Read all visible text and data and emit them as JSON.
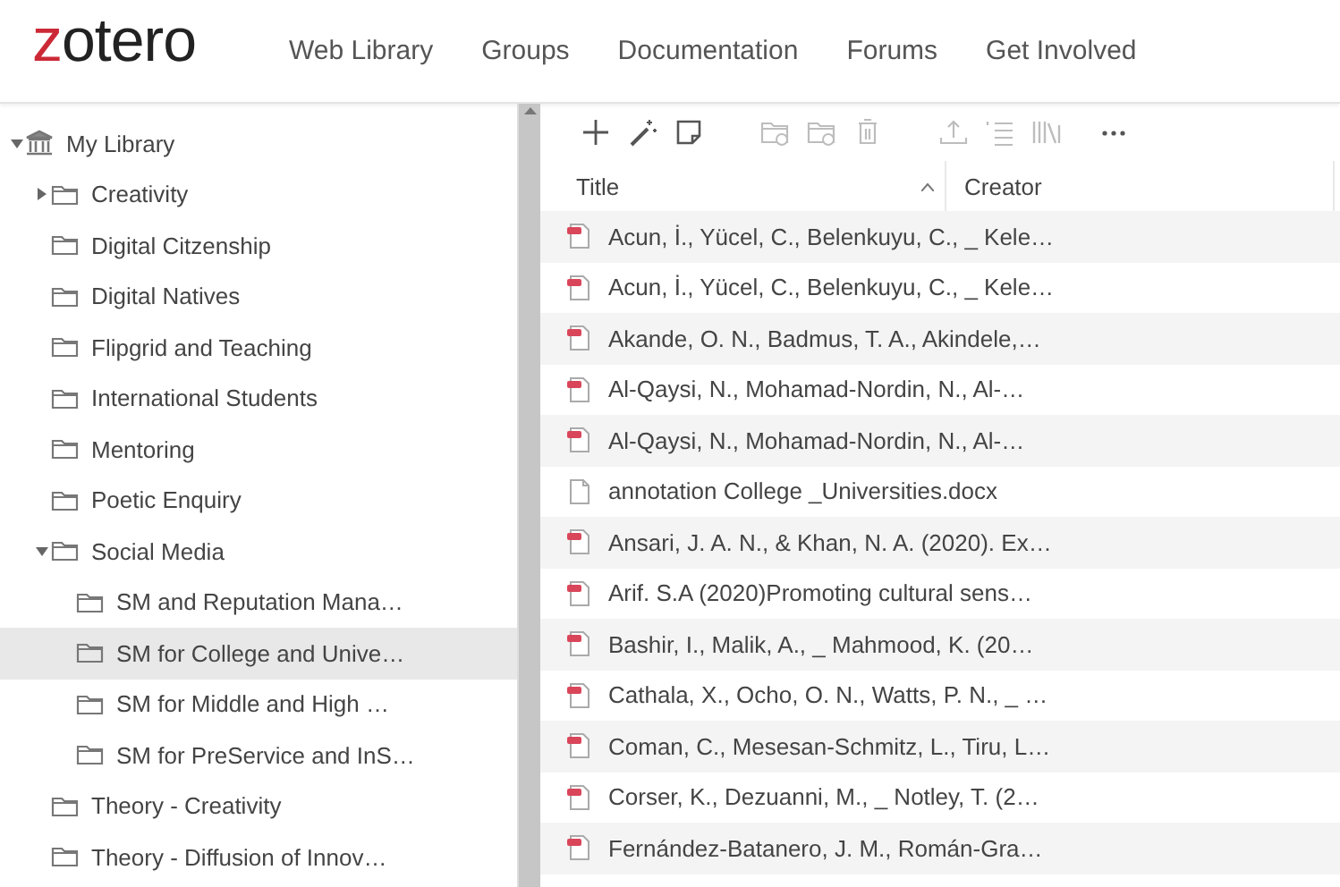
{
  "header": {
    "logo": {
      "accent": "z",
      "rest": "otero"
    },
    "nav": [
      {
        "label": "Web Library"
      },
      {
        "label": "Groups"
      },
      {
        "label": "Documentation"
      },
      {
        "label": "Forums"
      },
      {
        "label": "Get Involved"
      }
    ]
  },
  "sidebar": {
    "tree": [
      {
        "label": "My Library",
        "kind": "library",
        "expanded": true,
        "selected": false,
        "children": [
          {
            "label": "Creativity",
            "kind": "folder",
            "expanded": false,
            "selected": false
          },
          {
            "label": "Digital Citzenship",
            "kind": "folder",
            "selected": false
          },
          {
            "label": "Digital Natives",
            "kind": "folder",
            "selected": false
          },
          {
            "label": "Flipgrid and Teaching",
            "kind": "folder",
            "selected": false
          },
          {
            "label": "International Students",
            "kind": "folder",
            "selected": false
          },
          {
            "label": "Mentoring",
            "kind": "folder",
            "selected": false
          },
          {
            "label": "Poetic Enquiry",
            "kind": "folder",
            "selected": false
          },
          {
            "label": "Social Media",
            "kind": "folder",
            "expanded": true,
            "selected": false,
            "children": [
              {
                "label": "SM and Reputation Mana…",
                "kind": "folder",
                "selected": false
              },
              {
                "label": "SM for College and Unive…",
                "kind": "folder",
                "selected": true
              },
              {
                "label": "SM for Middle and High …",
                "kind": "folder",
                "selected": false
              },
              {
                "label": "SM for PreService and InS…",
                "kind": "folder",
                "selected": false
              }
            ]
          },
          {
            "label": "Theory - Creativity",
            "kind": "folder",
            "selected": false
          },
          {
            "label": "Theory - Diffusion of Innov…",
            "kind": "folder",
            "selected": false
          }
        ]
      }
    ]
  },
  "toolbar": [
    {
      "kind": "plus",
      "disabled": false
    },
    {
      "kind": "wand",
      "disabled": false
    },
    {
      "kind": "note",
      "disabled": false
    },
    {
      "kind": "folder-plus",
      "disabled": true
    },
    {
      "kind": "folder-minus",
      "disabled": true
    },
    {
      "kind": "trash",
      "disabled": true
    },
    {
      "kind": "upload",
      "disabled": true
    },
    {
      "kind": "list",
      "disabled": true
    },
    {
      "kind": "library",
      "disabled": true
    },
    {
      "kind": "more",
      "disabled": false
    }
  ],
  "table": {
    "columns": [
      {
        "label": "Title",
        "sort_ascending": true
      },
      {
        "label": "Creator"
      }
    ],
    "rows": [
      {
        "kind": "pdf",
        "title": "Acun, İ., Yücel, C., Belenkuyu, C., _ Kele…"
      },
      {
        "kind": "pdf",
        "title": "Acun, İ., Yücel, C., Belenkuyu, C., _ Kele…"
      },
      {
        "kind": "pdf",
        "title": "Akande, O. N., Badmus, T. A., Akindele,…"
      },
      {
        "kind": "pdf",
        "title": "Al-Qaysi, N., Mohamad-Nordin, N., Al-…"
      },
      {
        "kind": "pdf",
        "title": "Al-Qaysi, N., Mohamad-Nordin, N., Al-…"
      },
      {
        "kind": "document",
        "title": "annotation College _Universities.docx"
      },
      {
        "kind": "pdf",
        "title": "Ansari, J. A. N., & Khan, N. A. (2020). Ex…"
      },
      {
        "kind": "pdf",
        "title": "Arif. S.A (2020)Promoting cultural sens…"
      },
      {
        "kind": "pdf",
        "title": "Bashir, I., Malik, A., _ Mahmood, K. (20…"
      },
      {
        "kind": "pdf",
        "title": "Cathala, X., Ocho, O. N., Watts, P. N., _ …"
      },
      {
        "kind": "pdf",
        "title": "Coman, C., Mesesan-Schmitz, L., Tiru, L…"
      },
      {
        "kind": "pdf",
        "title": "Corser, K., Dezuanni, M., _ Notley, T. (2…"
      },
      {
        "kind": "pdf",
        "title": "Fernández-Batanero, J. M., Román-Gra…"
      }
    ]
  }
}
